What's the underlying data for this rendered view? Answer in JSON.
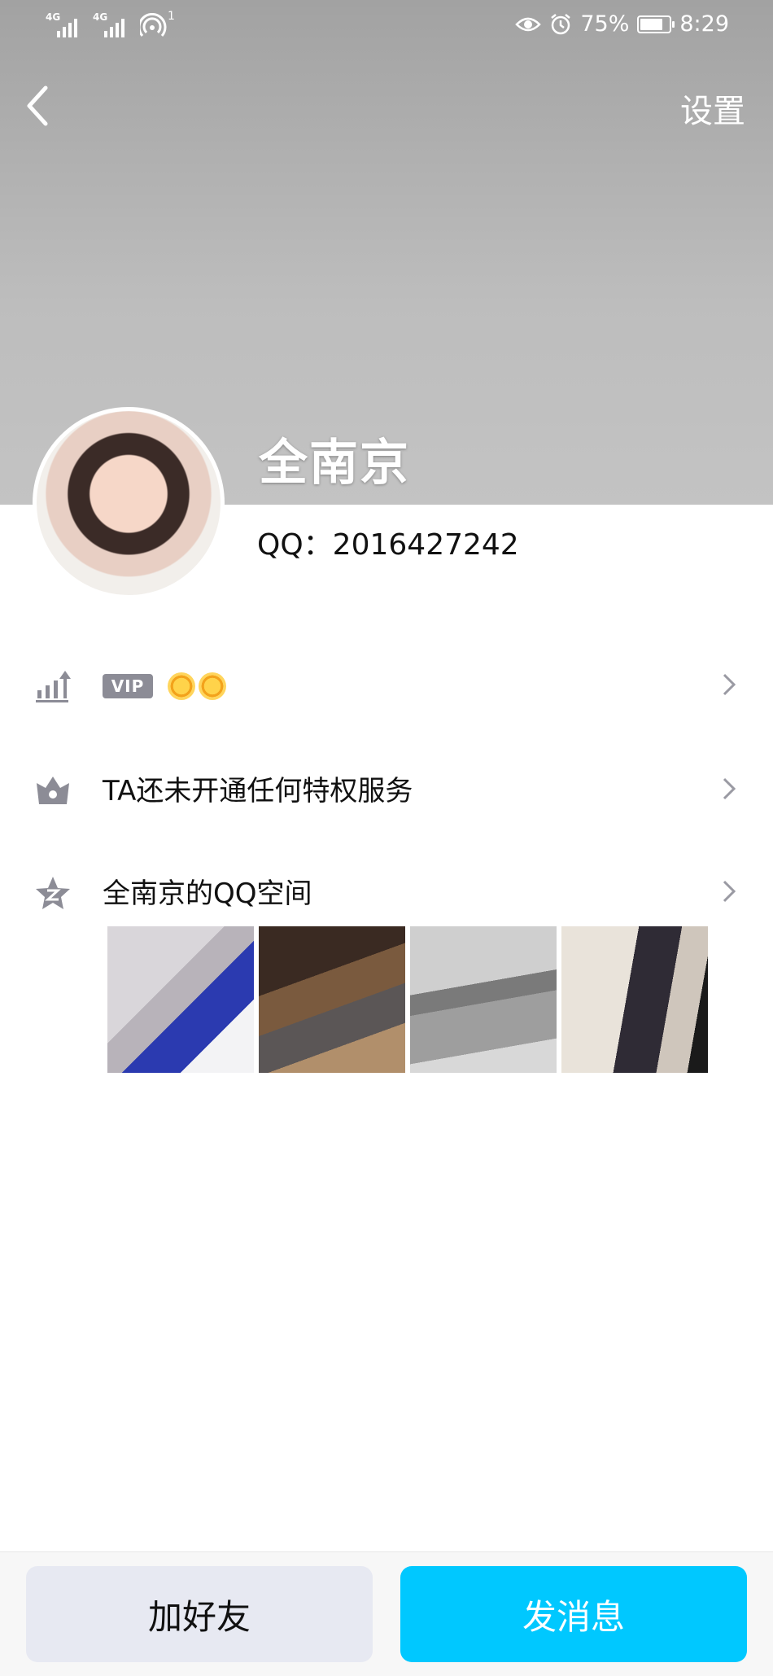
{
  "status_bar": {
    "network_1": "4G",
    "network_2": "4G",
    "hotspot_count": "1",
    "battery_percent": "75%",
    "time": "8:29"
  },
  "nav": {
    "settings_label": "设置"
  },
  "profile": {
    "name": "全南京",
    "qq_line": "QQ：2016427242"
  },
  "rows": {
    "level": {
      "badge": "VIP",
      "sun_count": 2
    },
    "privilege": {
      "label": "TA还未开通任何特权服务"
    },
    "qzone": {
      "label": "全南京的QQ空间",
      "photo_count": 4
    }
  },
  "actions": {
    "add_friend_label": "加好友",
    "send_message_label": "发消息"
  },
  "colors": {
    "accent": "#00c8ff",
    "secondary_button": "#e7e9f2",
    "icon_gray": "#8c8c96"
  }
}
